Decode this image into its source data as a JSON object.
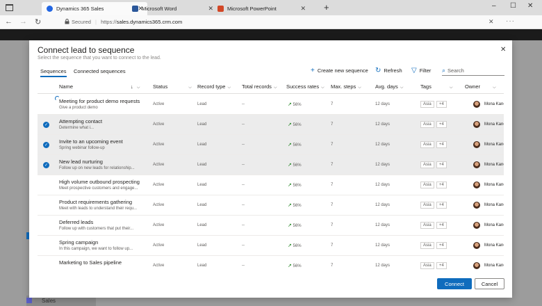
{
  "browser": {
    "tabs": [
      {
        "label": "Dynamics 365 Sales",
        "color": "#2266e3"
      },
      {
        "label": "Microsoft Word",
        "color": "#2b579a"
      },
      {
        "label": "Microsoft PowerPoint",
        "color": "#d24726"
      }
    ],
    "secured_label": "Secured",
    "url_prefix": "https://",
    "url_host": "sales.dynamics365.crm.com"
  },
  "app": {
    "area_label": "Sales"
  },
  "dialog": {
    "title": "Connect lead to sequence",
    "subtitle": "Select the sequence that you want to connect to the lead.",
    "tabs": [
      "Sequences",
      "Connected sequences"
    ],
    "toolbar": {
      "new_label": "Create new sequence",
      "refresh_label": "Refresh",
      "filter_label": "Filter",
      "search_placeholder": "Search"
    },
    "columns": {
      "name": "Name",
      "status": "Status",
      "record_type": "Record type",
      "total_records": "Total records",
      "success_rates": "Success rates",
      "max_steps": "Max. steps",
      "avg_days": "Avg. days",
      "tags": "Tags",
      "owner": "Owner"
    },
    "rows": [
      {
        "name": "Meeting for product demo requests",
        "desc": "Give a product demo",
        "status": "Active",
        "record_type": "Lead",
        "total": "--",
        "rate": "56%",
        "steps": "7",
        "days": "12 days",
        "tag": "Asia",
        "more": "+4",
        "owner": "Mona Kane"
      },
      {
        "name": "Attempting contact",
        "desc": "Determine what i...",
        "status": "Active",
        "record_type": "Lead",
        "total": "--",
        "rate": "56%",
        "steps": "7",
        "days": "12 days",
        "tag": "Asia",
        "more": "+4",
        "owner": "Mona Kane"
      },
      {
        "name": "Invite to an upcoming event",
        "desc": "Spring webinar follow-up",
        "status": "Active",
        "record_type": "Lead",
        "total": "--",
        "rate": "56%",
        "steps": "7",
        "days": "12 days",
        "tag": "Asia",
        "more": "+4",
        "owner": "Mona Kane"
      },
      {
        "name": "New lead nurturing",
        "desc": "Follow up on new leads for relationship...",
        "status": "Active",
        "record_type": "Lead",
        "total": "--",
        "rate": "56%",
        "steps": "7",
        "days": "12 days",
        "tag": "Asia",
        "more": "+4",
        "owner": "Mona Kane"
      },
      {
        "name": "High volume outbound prospecting",
        "desc": "Meet prospective customers and engage...",
        "status": "Active",
        "record_type": "Lead",
        "total": "--",
        "rate": "56%",
        "steps": "7",
        "days": "12 days",
        "tag": "Asia",
        "more": "+4",
        "owner": "Mona Kane"
      },
      {
        "name": "Product requirements gathering",
        "desc": "Meet with leads to understand their requ...",
        "status": "Active",
        "record_type": "Lead",
        "total": "--",
        "rate": "56%",
        "steps": "7",
        "days": "12 days",
        "tag": "Asia",
        "more": "+4",
        "owner": "Mona Kane"
      },
      {
        "name": "Deferred leads",
        "desc": "Follow up with customers that put their...",
        "status": "Active",
        "record_type": "Lead",
        "total": "--",
        "rate": "56%",
        "steps": "7",
        "days": "12 days",
        "tag": "Asia",
        "more": "+4",
        "owner": "Mona Kane"
      },
      {
        "name": "Spring campaign",
        "desc": "In this campaign, we want to follow up...",
        "status": "Active",
        "record_type": "Lead",
        "total": "--",
        "rate": "56%",
        "steps": "7",
        "days": "12 days",
        "tag": "Asia",
        "more": "+4",
        "owner": "Mona Kane"
      },
      {
        "name": "Marketing to Sales pipeline",
        "desc": "",
        "status": "Active",
        "record_type": "Lead",
        "total": "--",
        "rate": "56%",
        "steps": "7",
        "days": "12 days",
        "tag": "Asia",
        "more": "+4",
        "owner": "Mona Kane"
      }
    ],
    "selected_rows": [
      1,
      2,
      3
    ],
    "connect_label": "Connect",
    "cancel_label": "Cancel",
    "accent_color": "#0f6cbd"
  }
}
